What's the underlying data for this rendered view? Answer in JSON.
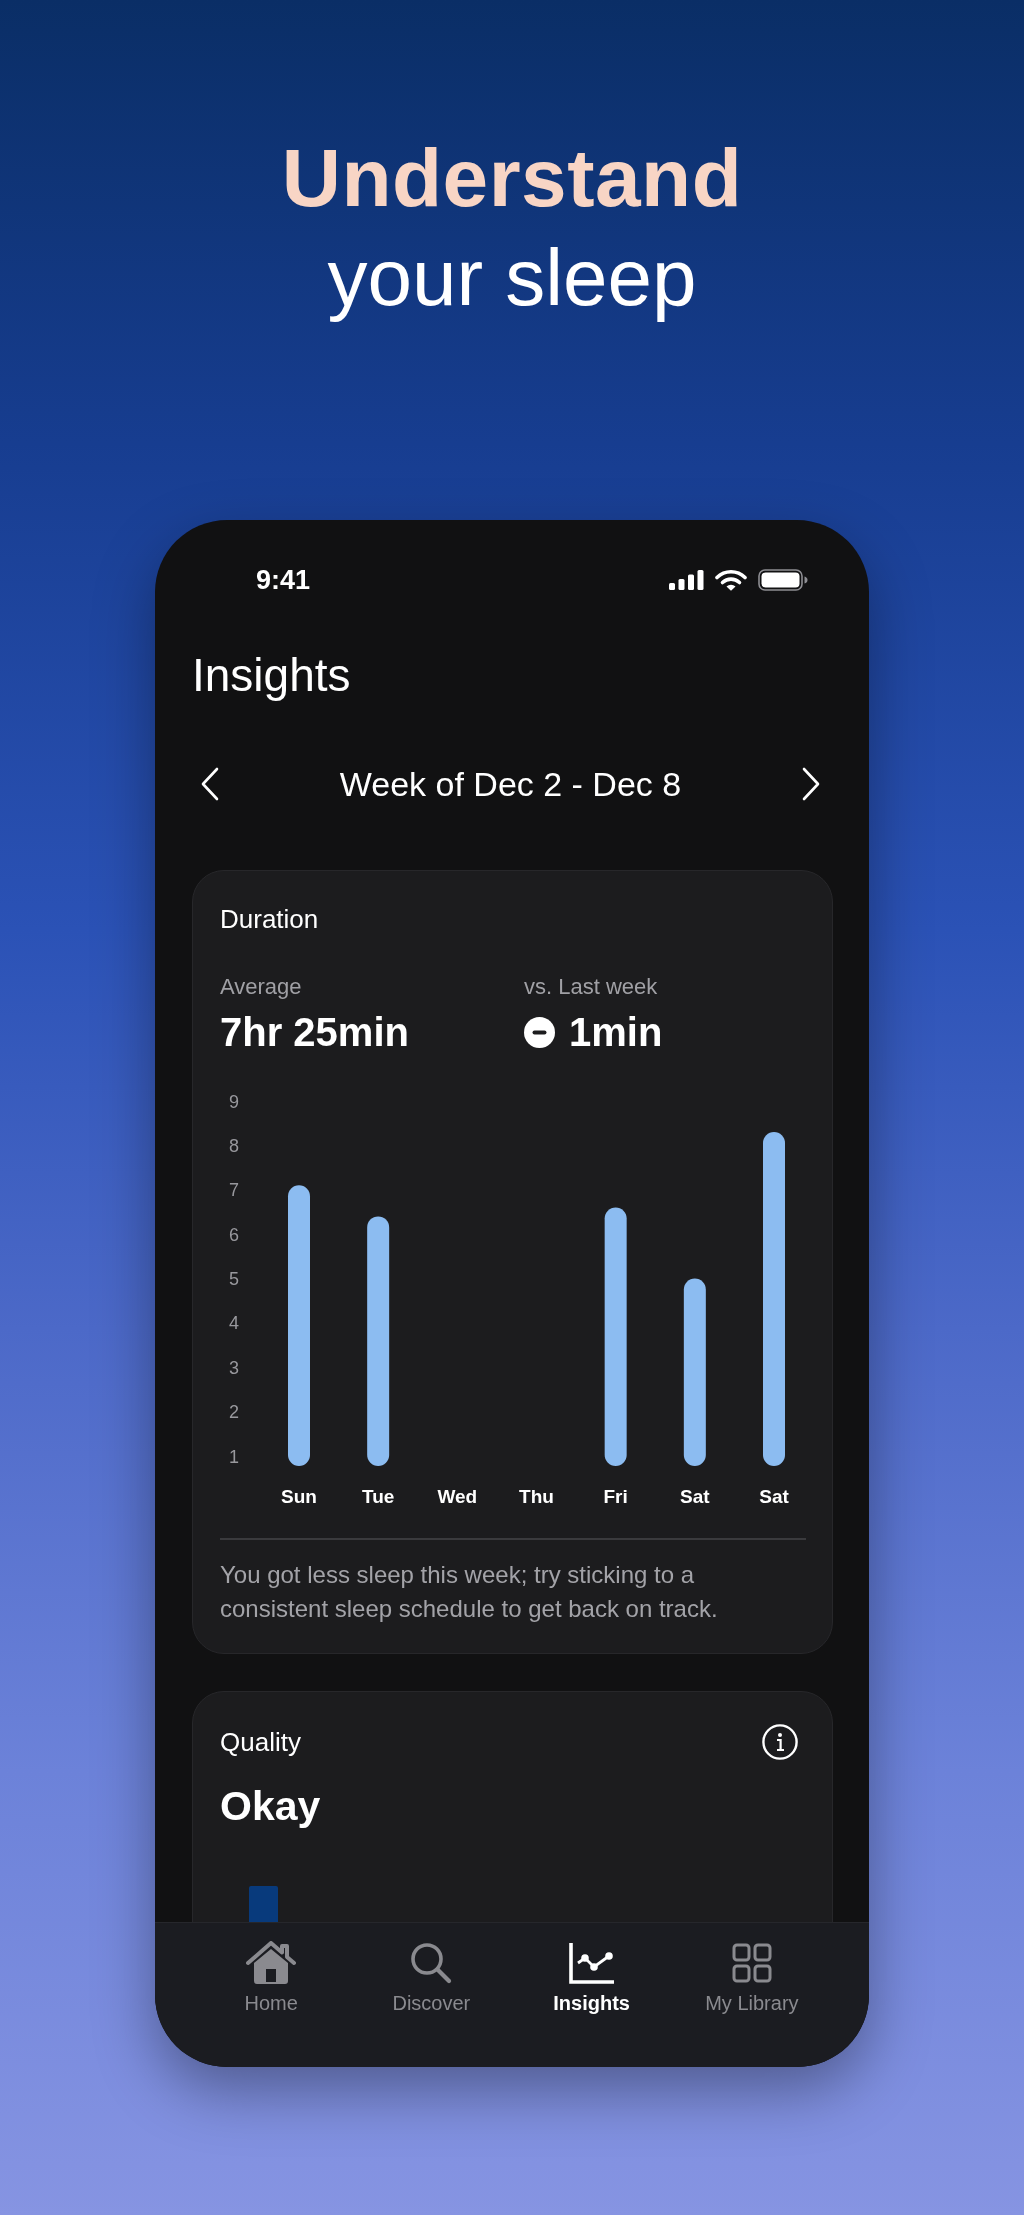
{
  "headline": {
    "highlight": "Understand",
    "rest": "your sleep"
  },
  "status_bar": {
    "time": "9:41"
  },
  "screen": {
    "title": "Insights",
    "week_label": "Week of Dec 2 - Dec 8"
  },
  "duration_card": {
    "title": "Duration",
    "stats": [
      {
        "label": "Average",
        "value": "7hr 25min",
        "kind": "plain"
      },
      {
        "label": "vs. Last week",
        "value": "1min",
        "kind": "decrease"
      }
    ],
    "chart_data": {
      "type": "bar",
      "categories": [
        "Sun",
        "Tue",
        "Wed",
        "Thu",
        "Fri",
        "Sat",
        "Sat"
      ],
      "values": [
        7.1,
        6.4,
        null,
        null,
        6.6,
        5.0,
        8.3
      ],
      "ylim": [
        1,
        9
      ],
      "yticks": [
        1,
        2,
        3,
        4,
        5,
        6,
        7,
        8,
        9
      ]
    },
    "message": "You got less sleep this week; try sticking to a consistent sleep schedule to get back on track."
  },
  "quality_card": {
    "title": "Quality",
    "value": "Okay"
  },
  "tab_bar": {
    "tabs": [
      {
        "label": "Home",
        "selected": false
      },
      {
        "label": "Discover",
        "selected": false
      },
      {
        "label": "Insights",
        "selected": true
      },
      {
        "label": "My Library",
        "selected": false
      }
    ]
  }
}
